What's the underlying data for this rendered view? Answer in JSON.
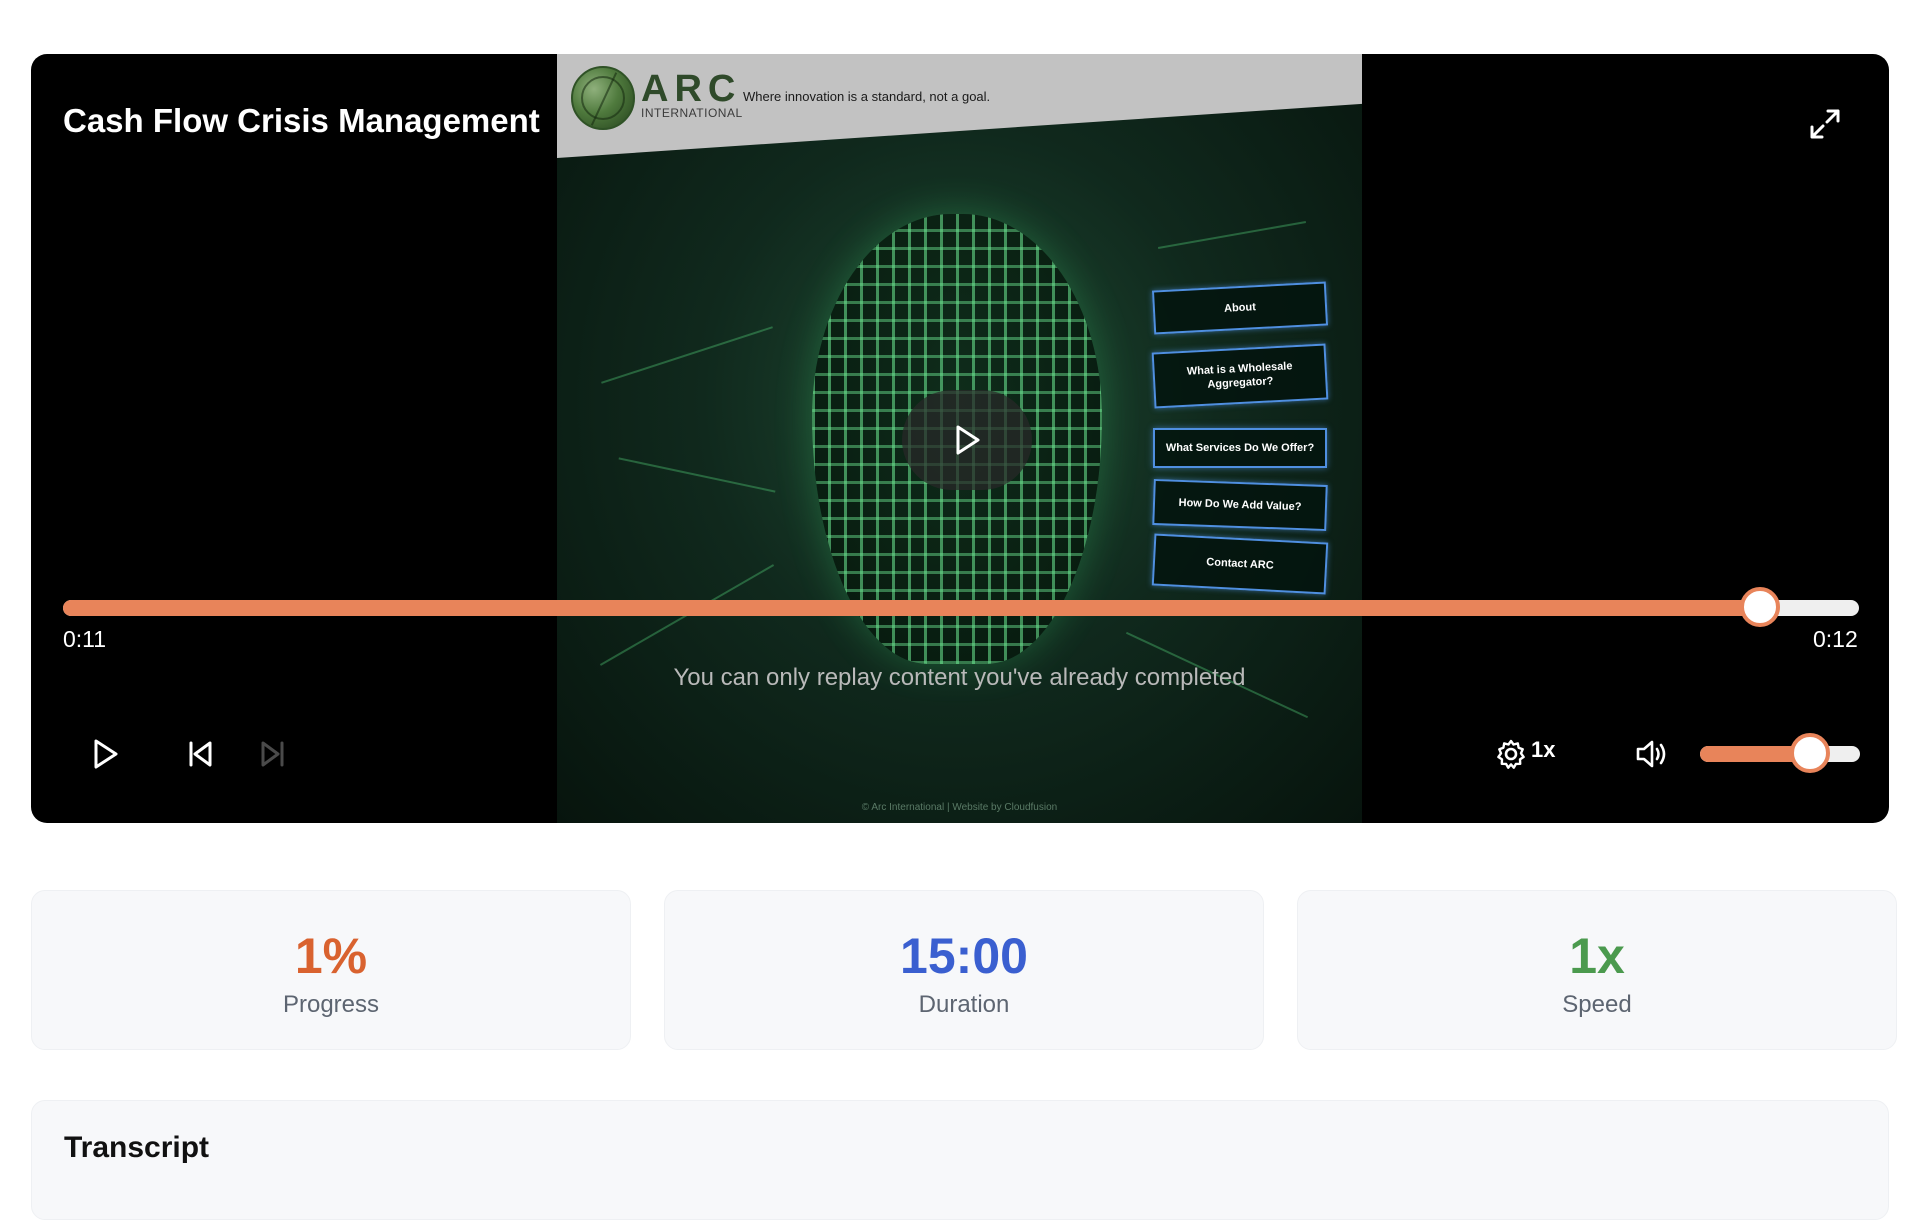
{
  "player": {
    "title": "Cash Flow Crisis Management",
    "current_time": "0:11",
    "total_time": "0:12",
    "seek_progress": 0.945,
    "notice": "You can only replay content you've already completed",
    "speed": "1x",
    "volume_level": 0.69,
    "icons": {
      "fullscreen": "expand-icon",
      "big_play": "play-icon",
      "play": "play-icon",
      "previous": "skip-back-icon",
      "next": "skip-forward-icon",
      "settings": "gear-icon",
      "volume": "volume-icon"
    }
  },
  "video_frame": {
    "logo_name": "ARC",
    "logo_sub": "INTERNATIONAL",
    "tagline": "Where innovation is a standard, not a goal.",
    "menu": [
      "About",
      "What is a Wholesale Aggregator?",
      "What Services Do We Offer?",
      "How Do We Add Value?",
      "Contact ARC"
    ],
    "footer": "© Arc International | Website by Cloudfusion"
  },
  "stats": [
    {
      "value": "1%",
      "label": "Progress",
      "color": "#d9622f"
    },
    {
      "value": "15:00",
      "label": "Duration",
      "color": "#3a5fd0"
    },
    {
      "value": "1x",
      "label": "Speed",
      "color": "#4b9a4e"
    }
  ],
  "transcript": {
    "heading": "Transcript"
  },
  "colors": {
    "accent": "#e8845a",
    "player_bg": "#000000",
    "card_bg": "#f7f8fa"
  }
}
